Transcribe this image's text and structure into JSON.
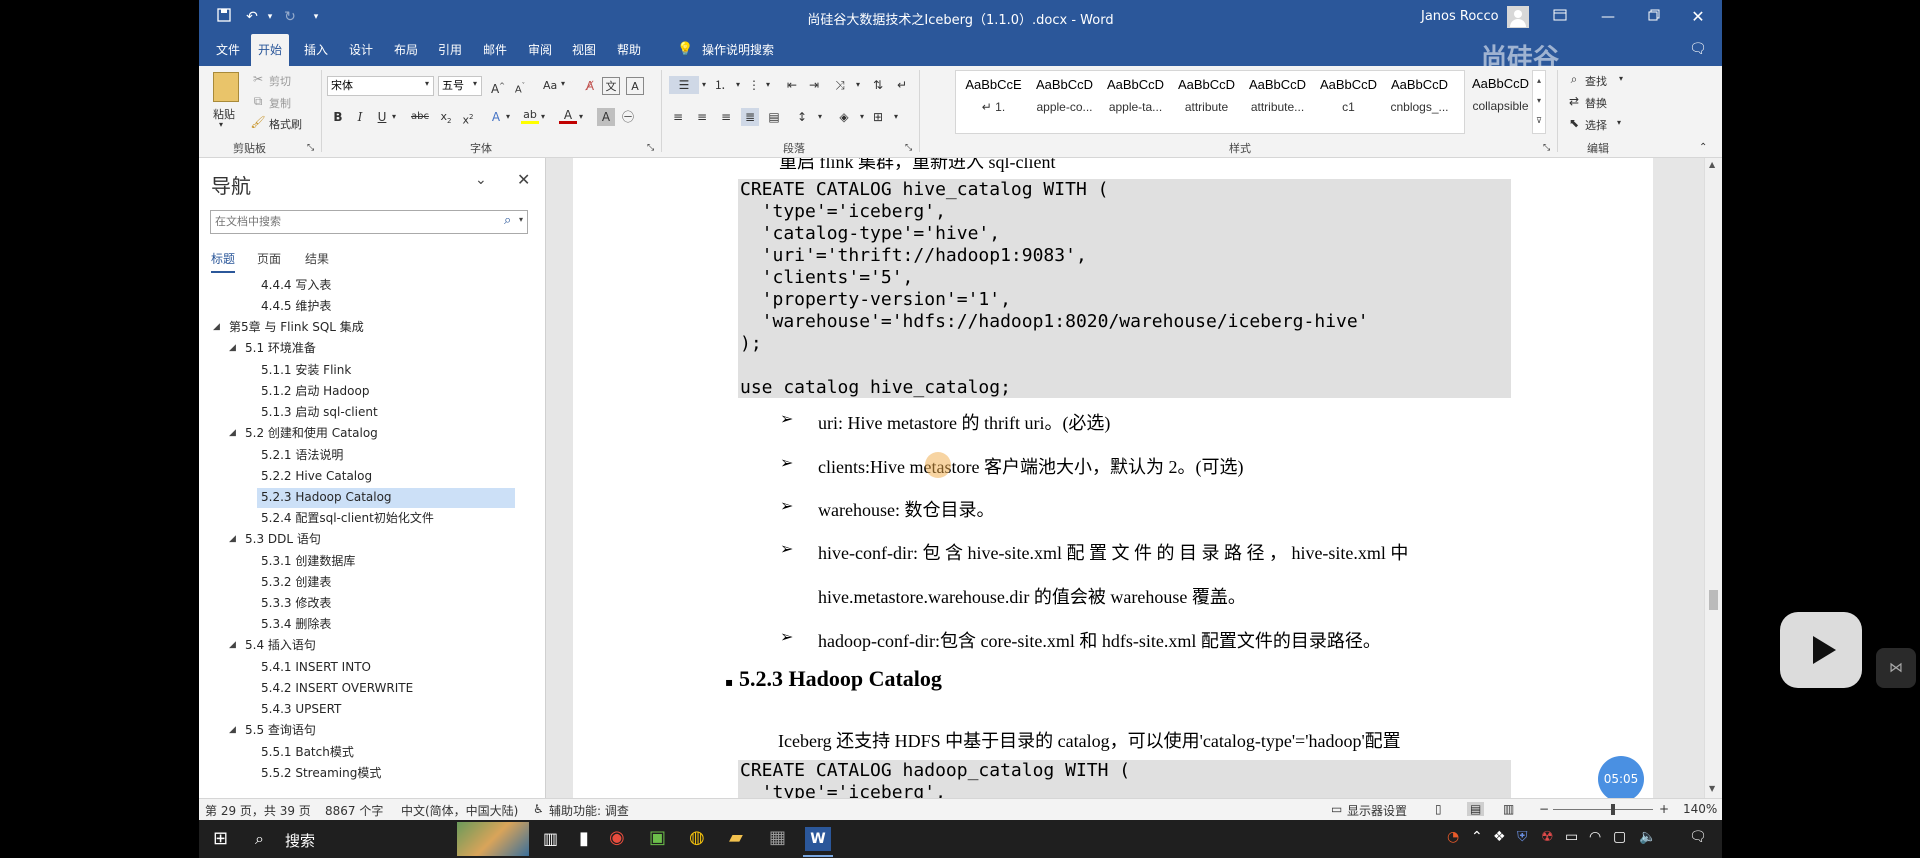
{
  "window": {
    "title": "尚硅谷大数据技术之Iceberg（1.1.0）.docx  -  Word",
    "user": "Janos Rocco",
    "watermark": "尚硅谷"
  },
  "tabs": [
    "文件",
    "开始",
    "插入",
    "设计",
    "布局",
    "引用",
    "邮件",
    "审阅",
    "视图",
    "帮助"
  ],
  "tell_me": "操作说明搜索",
  "ribbon": {
    "clipboard": {
      "paste": "粘贴",
      "cut": "剪切",
      "copy": "复制",
      "format_painter": "格式刷",
      "label": "剪贴板"
    },
    "font": {
      "name": "宋体",
      "size": "五号",
      "label": "字体",
      "btn_aa": "Aa"
    },
    "paragraph": {
      "label": "段落"
    },
    "styles": {
      "label": "样式",
      "items": [
        {
          "preview": "AaBbCcE",
          "name": "↵ 1."
        },
        {
          "preview": "AaBbCcD",
          "name": "apple-co..."
        },
        {
          "preview": "AaBbCcD",
          "name": "apple-ta..."
        },
        {
          "preview": "AaBbCcD",
          "name": "attribute"
        },
        {
          "preview": "AaBbCcD",
          "name": "attribute..."
        },
        {
          "preview": "AaBbCcD",
          "name": "c1"
        },
        {
          "preview": "AaBbCcD",
          "name": "cnblogs_..."
        },
        {
          "preview": "AaBbCcD",
          "name": "collapsible"
        }
      ]
    },
    "editing": {
      "find": "查找",
      "replace": "替换",
      "select": "选择",
      "label": "编辑"
    }
  },
  "nav": {
    "title": "导航",
    "search_placeholder": "在文档中搜索",
    "tabs": [
      "标题",
      "页面",
      "结果"
    ],
    "items": [
      {
        "text": "4.4.4 写入表",
        "level": 3
      },
      {
        "text": "4.4.5 维护表",
        "level": 3
      },
      {
        "text": "第5章 与 Flink SQL 集成",
        "level": 1
      },
      {
        "text": "5.1 环境准备",
        "level": 2
      },
      {
        "text": "5.1.1 安装 Flink",
        "level": 3
      },
      {
        "text": "5.1.2 启动 Hadoop",
        "level": 3
      },
      {
        "text": "5.1.3 启动 sql-client",
        "level": 3
      },
      {
        "text": "5.2 创建和使用 Catalog",
        "level": 2
      },
      {
        "text": "5.2.1 语法说明",
        "level": 3
      },
      {
        "text": "5.2.2 Hive Catalog",
        "level": 3
      },
      {
        "text": "5.2.3 Hadoop Catalog",
        "level": 3,
        "selected": true
      },
      {
        "text": "5.2.4 配置sql-client初始化文件",
        "level": 3
      },
      {
        "text": "5.3 DDL 语句",
        "level": 2
      },
      {
        "text": "5.3.1 创建数据库",
        "level": 3
      },
      {
        "text": "5.3.2 创建表",
        "level": 3
      },
      {
        "text": "5.3.3 修改表",
        "level": 3
      },
      {
        "text": "5.3.4 删除表",
        "level": 3
      },
      {
        "text": "5.4 插入语句",
        "level": 2
      },
      {
        "text": "5.4.1 INSERT INTO",
        "level": 3
      },
      {
        "text": "5.4.2 INSERT OVERWRITE",
        "level": 3
      },
      {
        "text": "5.4.3 UPSERT",
        "level": 3
      },
      {
        "text": "5.5 查询语句",
        "level": 2
      },
      {
        "text": "5.5.1 Batch模式",
        "level": 3
      },
      {
        "text": "5.5.2 Streaming模式",
        "level": 3
      }
    ]
  },
  "document": {
    "top_partial": "重启 flink 集群，重新进入 sql-client",
    "code1": [
      "CREATE CATALOG hive_catalog WITH (",
      "  'type'='iceberg',",
      "  'catalog-type'='hive',",
      "  'uri'='thrift://hadoop1:9083',",
      "  'clients'='5',",
      "  'property-version'='1',",
      "  'warehouse'='hdfs://hadoop1:8020/warehouse/iceberg-hive'",
      ");",
      "",
      "use catalog hive_catalog;"
    ],
    "bullets": [
      "uri: Hive metastore 的 thrift uri。(必选)",
      "clients:Hive metastore 客户端池大小，默认为 2。(可选)",
      "warehouse:  数仓目录。",
      "hive-conf-dir: 包 含   hive-site.xml   配 置 文 件 的 目 录 路 径 ，  hive-site.xml   中",
      "hive.metastore.warehouse.dir  的值会被 warehouse 覆盖。",
      "hadoop-conf-dir:包含 core-site.xml 和 hdfs-site.xml 配置文件的目录路径。"
    ],
    "heading": "5.2.3 Hadoop Catalog",
    "intro": "Iceberg 还支持 HDFS 中基于目录的 catalog，可以使用'catalog-type'='hadoop'配置",
    "code2": [
      "CREATE CATALOG hadoop_catalog WITH (",
      "  'type'='iceberg',"
    ]
  },
  "status": {
    "page": "第 29 页，共 39 页",
    "words": "8867 个字",
    "lang": "中文(简体，中国大陆)",
    "accessibility": "辅助功能: 调查",
    "display": "显示器设置",
    "zoom": "140%"
  },
  "taskbar": {
    "search": "搜索"
  },
  "overlay": {
    "timer": "05:05"
  },
  "colors": {
    "accent": "#2b579a",
    "selected_nav": "#cce0f7",
    "code_bg": "#e0e0e0"
  }
}
